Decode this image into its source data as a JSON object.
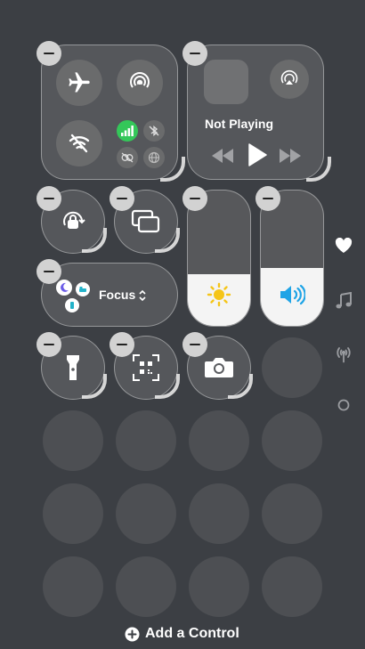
{
  "now_playing": {
    "status": "Not Playing"
  },
  "focus": {
    "label": "Focus"
  },
  "add_control": {
    "label": "Add a Control"
  },
  "colors": {
    "background": "#3c3f44",
    "cellular_active": "#34c759",
    "brightness_icon": "#f5c518",
    "volume_icon": "#1fa4e6"
  },
  "sliders": {
    "brightness": {
      "level": 0.38
    },
    "volume": {
      "level": 0.43
    }
  },
  "side_nav": [
    "heart-icon",
    "music-icon",
    "antenna-icon",
    "circle-icon"
  ]
}
